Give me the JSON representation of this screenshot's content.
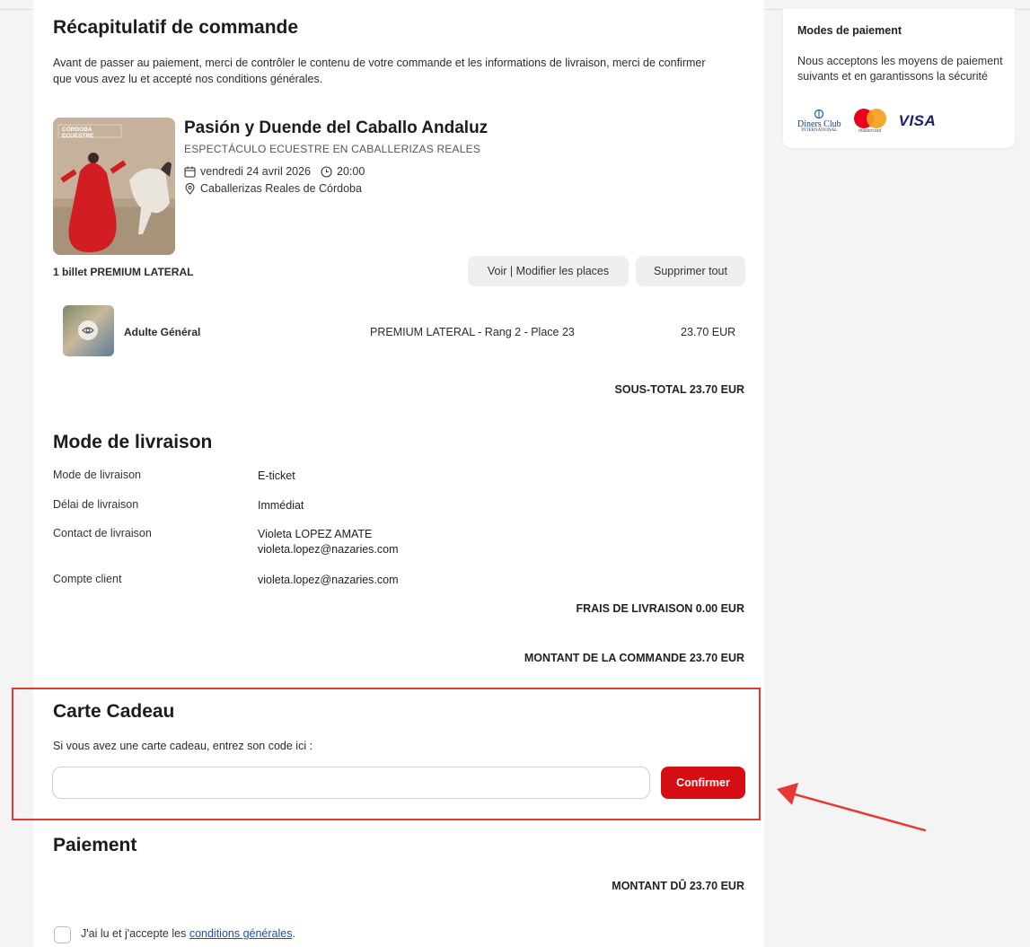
{
  "summary": {
    "title": "Récapitulatif de commande",
    "intro": "Avant de passer au paiement, merci de contrôler le contenu de votre commande et les informations de livraison, merci de confirmer que vous avez lu et accepté nos conditions générales."
  },
  "event": {
    "poster_logo": "CÓRDOBA ECUESTRE",
    "title": "Pasión y Duende del Caballo Andaluz",
    "subtitle": "ESPECTÁCULO ECUESTRE EN CABALLERIZAS REALES",
    "date": "vendredi 24 avril 2026",
    "time": "20:00",
    "venue": "Caballerizas Reales de Córdoba"
  },
  "tickets": {
    "count_label": "1 billet PREMIUM LATERAL",
    "view_modify_label": "Voir | Modifier les places",
    "delete_all_label": "Supprimer tout",
    "rows": [
      {
        "type": "Adulte Général",
        "seat": "PREMIUM LATERAL - Rang 2 - Place 23",
        "price": "23.70 EUR"
      }
    ],
    "subtotal": "SOUS-TOTAL  23.70 EUR"
  },
  "delivery": {
    "title": "Mode de livraison",
    "rows": [
      {
        "label": "Mode de livraison",
        "value": "E-ticket"
      },
      {
        "label": "Délai de livraison",
        "value": "Immédiat"
      },
      {
        "label": "Contact de livraison",
        "value": "Violeta LOPEZ AMATE",
        "value2": "violeta.lopez@nazaries.com"
      },
      {
        "label": "Compte client",
        "value": "violeta.lopez@nazaries.com"
      }
    ],
    "fee": "FRAIS DE LIVRAISON  0.00 EUR",
    "order_total": "MONTANT DE LA COMMANDE 23.70 EUR"
  },
  "gift_card": {
    "title": "Carte Cadeau",
    "prompt": "Si vous avez une carte cadeau, entrez son code ici :",
    "input_value": "",
    "confirm_label": "Confirmer"
  },
  "payment": {
    "title": "Paiement",
    "amount_due": "MONTANT DÛ 23.70 EUR",
    "terms_prefix": "J'ai lu et j'accepte les ",
    "terms_link": "conditions générales",
    "terms_suffix": "."
  },
  "sidebar": {
    "title": "Modes de paiement",
    "text": "Nous acceptons les moyens de paiement suivants et en garantissons la sécurité",
    "methods": {
      "diners_line1": "Diners Club",
      "diners_line2": "INTERNATIONAL",
      "mastercard": "mastercard",
      "visa": "VISA"
    }
  },
  "colors": {
    "accent": "#d50e14",
    "annotation": "#e53935"
  }
}
